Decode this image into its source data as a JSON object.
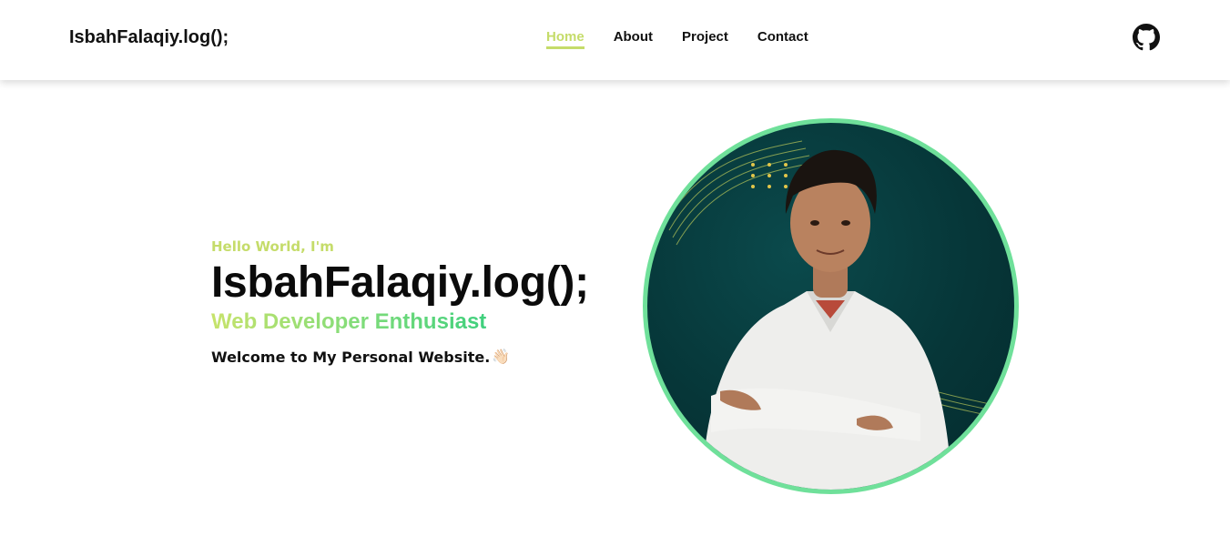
{
  "nav": {
    "brand": "IsbahFalaqiy.log();",
    "links": [
      {
        "label": "Home",
        "active": true
      },
      {
        "label": "About",
        "active": false
      },
      {
        "label": "Project",
        "active": false
      },
      {
        "label": "Contact",
        "active": false
      }
    ],
    "github_icon": "github-icon"
  },
  "hero": {
    "greeting": "Hello World, I'm",
    "title": "IsbahFalaqiy.log();",
    "subtitle": "Web Developer Enthusiast",
    "welcome": "Welcome to My Personal Website.",
    "wave_icon": "👋🏻",
    "avatar_icon": "profile-photo"
  },
  "colors": {
    "accent": "#c5dc6a",
    "gradient_end": "#3fd07d",
    "avatar_border": "#6fe09a",
    "avatar_bg": "#063638"
  }
}
